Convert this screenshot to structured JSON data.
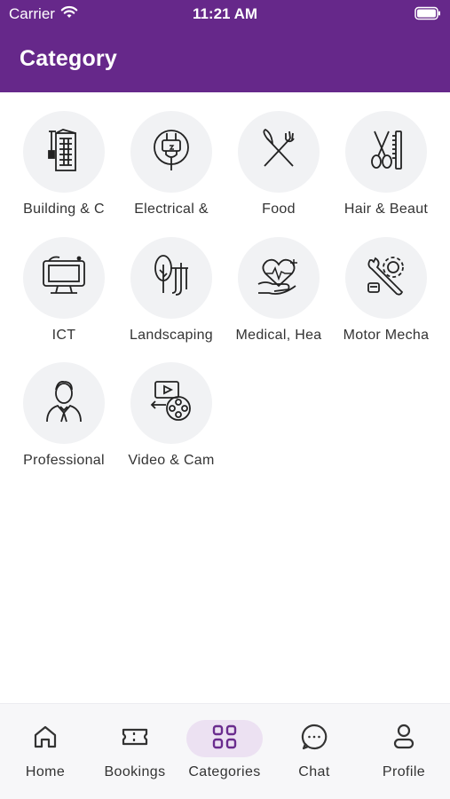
{
  "status_bar": {
    "carrier": "Carrier",
    "time": "11:21 AM"
  },
  "header": {
    "title": "Category"
  },
  "categories": [
    {
      "label": "Building & C",
      "icon": "building-icon"
    },
    {
      "label": "Electrical &",
      "icon": "plug-icon"
    },
    {
      "label": "Food",
      "icon": "fork-knife-icon"
    },
    {
      "label": "Hair & Beaut",
      "icon": "scissors-comb-icon"
    },
    {
      "label": "ICT",
      "icon": "computer-monitor-icon"
    },
    {
      "label": "Landscaping",
      "icon": "trees-icon"
    },
    {
      "label": "Medical, Hea",
      "icon": "heart-hand-icon"
    },
    {
      "label": "Motor Mecha",
      "icon": "wrench-gear-icon"
    },
    {
      "label": "Professional",
      "icon": "businessman-icon"
    },
    {
      "label": "Video & Cam",
      "icon": "video-reel-icon"
    }
  ],
  "tabbar": {
    "items": [
      {
        "label": "Home",
        "icon": "home-icon"
      },
      {
        "label": "Bookings",
        "icon": "ticket-icon"
      },
      {
        "label": "Categories",
        "icon": "grid-icon",
        "active": true
      },
      {
        "label": "Chat",
        "icon": "chat-bubble-icon"
      },
      {
        "label": "Profile",
        "icon": "person-icon"
      }
    ]
  },
  "colors": {
    "brand": "#66288a",
    "active_tab_bg": "#ece1f2",
    "circle_bg": "#f1f2f4"
  }
}
